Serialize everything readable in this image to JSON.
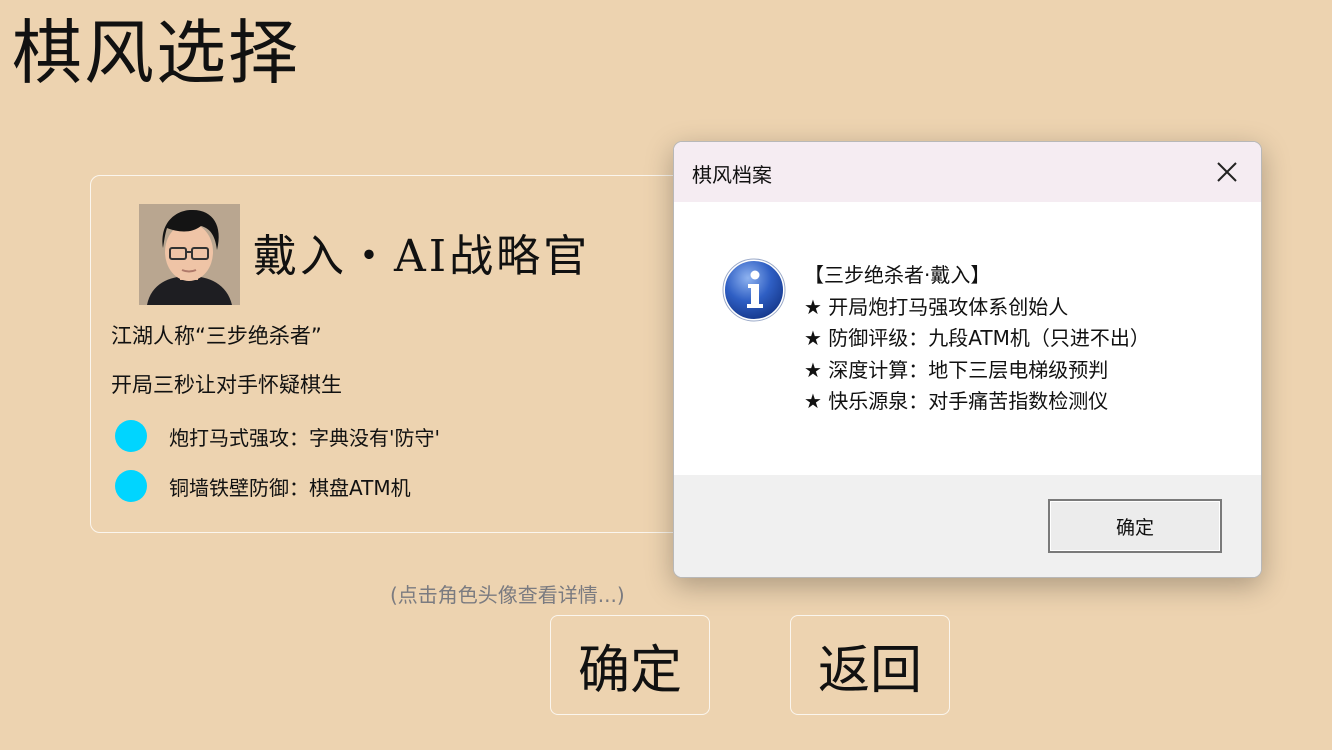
{
  "page": {
    "title": "棋风选择"
  },
  "card": {
    "name": "戴入・AI战略官",
    "line1": "江湖人称“三步绝杀者”",
    "line2": "开局三秒让对手怀疑棋生",
    "traits": [
      {
        "text": "炮打马式强攻：字典没有'防守'"
      },
      {
        "text": "铜墙铁壁防御：棋盘ATM机"
      }
    ],
    "dot_color": "#00d5ff"
  },
  "hint": "(点击角色头像查看详情...)",
  "buttons": {
    "confirm": "确定",
    "back": "返回"
  },
  "dialog": {
    "title": "棋风档案",
    "close_icon": "close-icon",
    "icon": "info-icon",
    "lines": [
      "【三步绝杀者·戴入】",
      "★ 开局炮打马强攻体系创始人",
      "★ 防御评级：九段ATM机（只进不出）",
      "★ 深度计算：地下三层电梯级预判",
      "★ 快乐源泉：对手痛苦指数检测仪"
    ],
    "ok": "确定"
  },
  "colors": {
    "background": "#edd3b0",
    "accent": "#00d5ff",
    "hint": "#7b7b80"
  }
}
